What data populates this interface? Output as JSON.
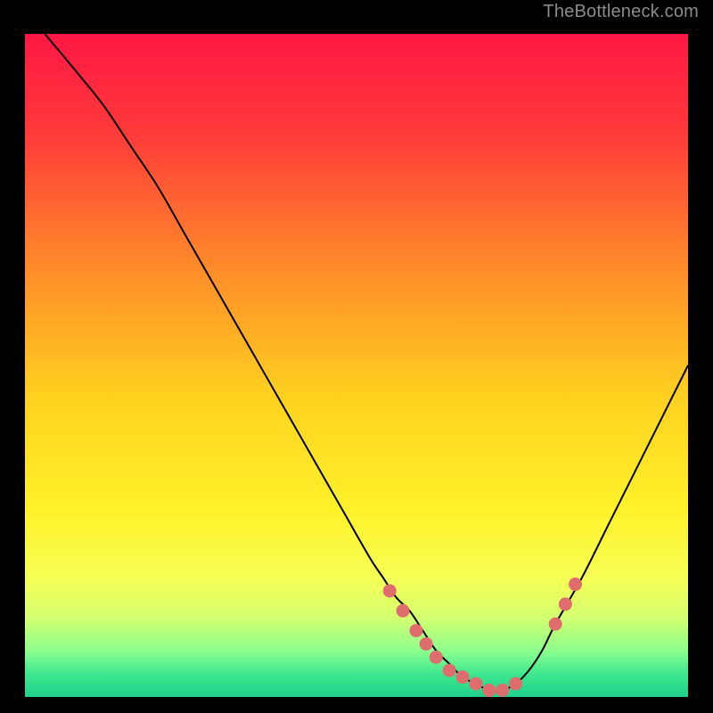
{
  "watermark": "TheBottleneck.com",
  "chart_data": {
    "type": "line",
    "title": "",
    "xlabel": "",
    "ylabel": "",
    "xlim": [
      0,
      100
    ],
    "ylim": [
      0,
      100
    ],
    "series": [
      {
        "name": "bottleneck-curve",
        "x": [
          3,
          8,
          12,
          16,
          20,
          24,
          28,
          32,
          36,
          40,
          44,
          48,
          52,
          54,
          56,
          58,
          60,
          62,
          64,
          66,
          68,
          70,
          72,
          74,
          76,
          78,
          80,
          84,
          88,
          92,
          96,
          100
        ],
        "y": [
          100,
          94,
          89,
          83,
          77,
          70,
          63,
          56,
          49,
          42,
          35,
          28,
          21,
          18,
          15,
          13,
          10,
          7,
          5,
          3,
          2,
          1,
          1,
          2,
          4,
          7,
          11,
          18,
          26,
          34,
          42,
          50
        ]
      }
    ],
    "dots": {
      "name": "highlight-dots",
      "x": [
        55,
        57,
        59,
        60.5,
        62,
        64,
        66,
        68,
        70,
        72,
        74,
        80,
        81.5,
        83
      ],
      "y": [
        16,
        13,
        10,
        8,
        6,
        4,
        3,
        2,
        1,
        1,
        2,
        11,
        14,
        17
      ]
    },
    "background_gradient": {
      "stops": [
        {
          "pos": 0.0,
          "color": "#ff1744"
        },
        {
          "pos": 0.15,
          "color": "#ff3a3a"
        },
        {
          "pos": 0.35,
          "color": "#ff8a2a"
        },
        {
          "pos": 0.55,
          "color": "#ffd21f"
        },
        {
          "pos": 0.72,
          "color": "#fff22a"
        },
        {
          "pos": 0.82,
          "color": "#f6ff55"
        },
        {
          "pos": 0.88,
          "color": "#d4ff70"
        },
        {
          "pos": 0.93,
          "color": "#8dff8d"
        },
        {
          "pos": 0.965,
          "color": "#3fe88f"
        },
        {
          "pos": 1.0,
          "color": "#1fd08a"
        }
      ]
    }
  }
}
